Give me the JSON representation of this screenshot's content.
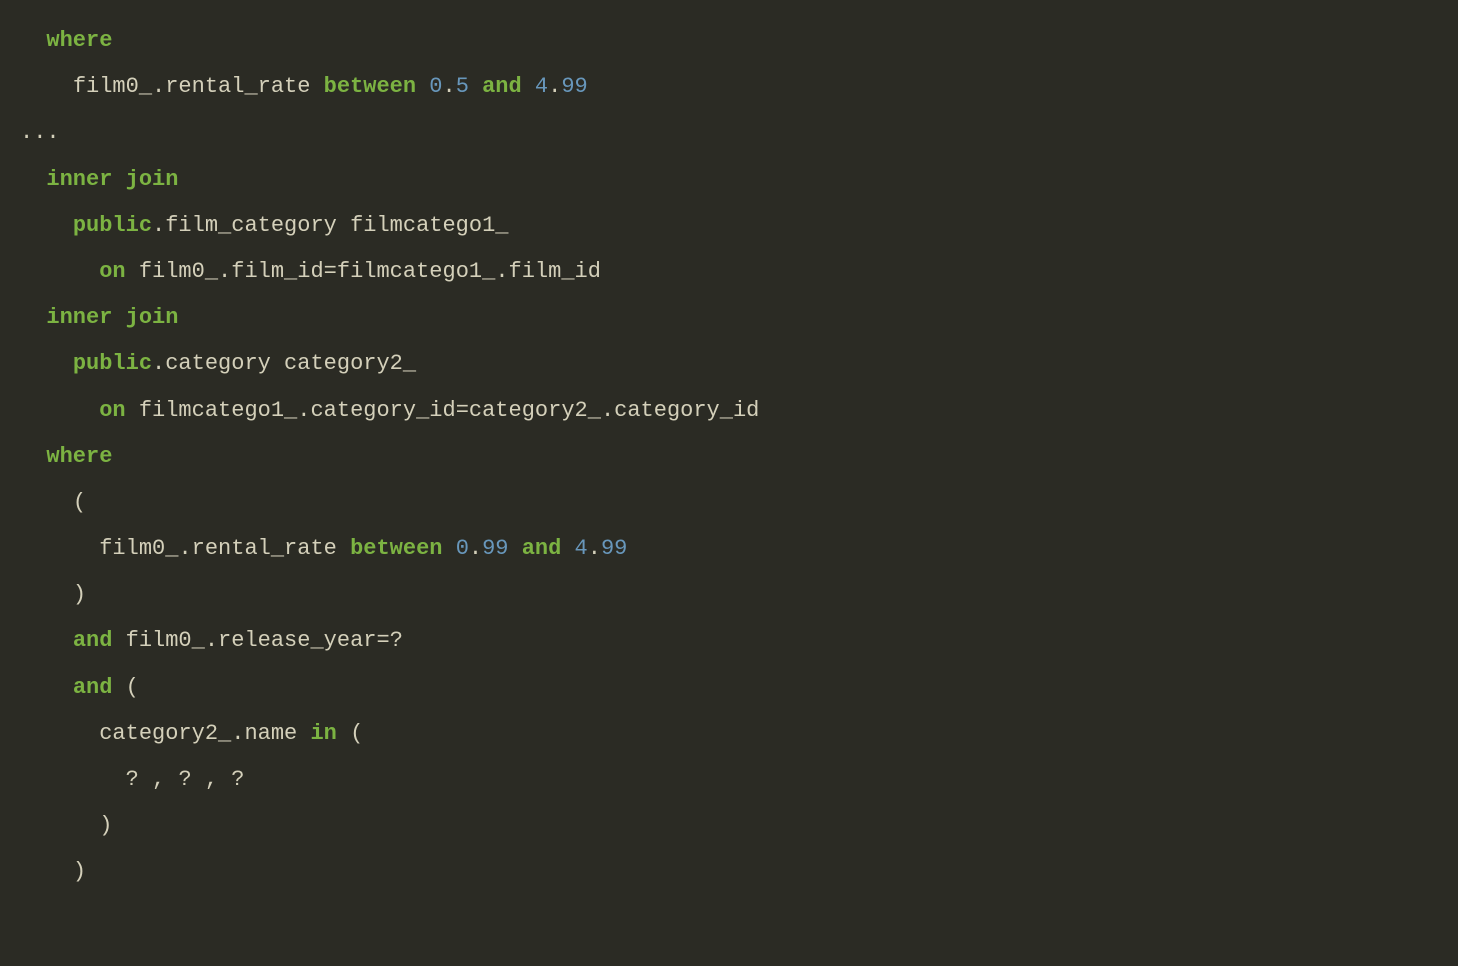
{
  "code": {
    "line1": {
      "indent": "  ",
      "kw1": "where"
    },
    "line2": {
      "indent": "    ",
      "ident1": "film0_",
      "punct1": ".",
      "ident2": "rental_rate ",
      "kw1": "between",
      "sp1": " ",
      "num1": "0",
      "punct2": ".",
      "num2": "5",
      "sp2": " ",
      "kw2": "and",
      "sp3": " ",
      "num3": "4",
      "punct3": ".",
      "num4": "99"
    },
    "line3": {
      "punct1": "..."
    },
    "line4": {
      "indent": "  ",
      "kw1": "inner",
      "sp1": " ",
      "kw2": "join"
    },
    "line5": {
      "indent": "    ",
      "schema1": "public",
      "punct1": ".",
      "ident1": "film_category filmcatego1_ "
    },
    "line6": {
      "indent": "      ",
      "kw1": "on",
      "sp1": " ",
      "ident1": "film0_",
      "punct1": ".",
      "ident2": "film_id",
      "punct2": "=",
      "ident3": "filmcatego1_",
      "punct3": ".",
      "ident4": "film_id "
    },
    "line7": {
      "indent": "  ",
      "kw1": "inner",
      "sp1": " ",
      "kw2": "join"
    },
    "line8": {
      "indent": "    ",
      "schema1": "public",
      "punct1": ".",
      "ident1": "category category2_ "
    },
    "line9": {
      "indent": "      ",
      "kw1": "on",
      "sp1": " ",
      "ident1": "filmcatego1_",
      "punct1": ".",
      "ident2": "category_id",
      "punct2": "=",
      "ident3": "category2_",
      "punct3": ".",
      "ident4": "category_id "
    },
    "line10": {
      "indent": "  ",
      "kw1": "where"
    },
    "line11": {
      "indent": "    ",
      "punct1": "("
    },
    "line12": {
      "indent": "      ",
      "ident1": "film0_",
      "punct1": ".",
      "ident2": "rental_rate ",
      "kw1": "between",
      "sp1": " ",
      "num1": "0",
      "punct2": ".",
      "num2": "99",
      "sp2": " ",
      "kw2": "and",
      "sp3": " ",
      "num3": "4",
      "punct3": ".",
      "num4": "99"
    },
    "line13": {
      "indent": "    ",
      "punct1": ") "
    },
    "line14": {
      "indent": "    ",
      "kw1": "and",
      "sp1": " ",
      "ident1": "film0_",
      "punct1": ".",
      "ident2": "release_year",
      "punct2": "=",
      "punct3": "? "
    },
    "line15": {
      "indent": "    ",
      "kw1": "and",
      "sp1": " ",
      "punct1": "("
    },
    "line16": {
      "indent": "      ",
      "ident1": "category2_",
      "punct1": ".",
      "ident2": "name ",
      "kw1": "in",
      "sp1": " ",
      "punct2": "("
    },
    "line17": {
      "indent": "        ",
      "punct1": "? ",
      "punct2": ",",
      "sp1": " ",
      "punct3": "? ",
      "punct4": ",",
      "sp2": " ",
      "punct5": "?"
    },
    "line18": {
      "indent": "      ",
      "punct1": ")"
    },
    "line19": {
      "indent": "    ",
      "punct1": ")"
    }
  }
}
